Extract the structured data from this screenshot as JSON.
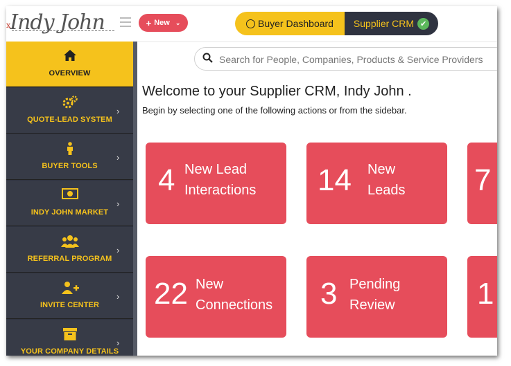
{
  "header": {
    "logo_text": "Indy John",
    "logo_mark": "x",
    "new_label": "New",
    "toggle": {
      "buyer_label": "Buyer Dashboard",
      "supplier_label": "Supplier CRM"
    }
  },
  "sidebar": {
    "items": [
      {
        "label": "OVERVIEW",
        "icon": "home-icon",
        "active": true
      },
      {
        "label": "QUOTE-LEAD SYSTEM",
        "icon": "gears-icon"
      },
      {
        "label": "BUYER TOOLS",
        "icon": "person-icon"
      },
      {
        "label": "INDY JOHN MARKET",
        "icon": "money-icon"
      },
      {
        "label": "REFERRAL PROGRAM",
        "icon": "users-icon"
      },
      {
        "label": "INVITE CENTER",
        "icon": "user-plus-icon"
      },
      {
        "label": "YOUR COMPANY DETAILS",
        "icon": "box-icon"
      }
    ]
  },
  "search": {
    "placeholder": "Search for People, Companies, Products & Service Providers"
  },
  "main": {
    "welcome": "Welcome to your Supplier CRM, Indy John .",
    "subtitle": "Begin by selecting one of the following actions or from the sidebar.",
    "cards_row1": [
      {
        "number": "4",
        "line1": "New Lead",
        "line2": "Interactions"
      },
      {
        "number": "14",
        "line1": "New",
        "line2": "Leads"
      },
      {
        "number": "7",
        "line1": "",
        "line2": ""
      }
    ],
    "cards_row2": [
      {
        "number": "22",
        "line1": "New",
        "line2": "Connections"
      },
      {
        "number": "3",
        "line1": "Pending",
        "line2": "Review"
      },
      {
        "number": "1",
        "line1": "",
        "line2": ""
      }
    ]
  },
  "colors": {
    "accent_yellow": "#f5c21c",
    "card_red": "#e64d5b",
    "sidebar_dark": "#373b47",
    "check_green": "#5cb85c"
  }
}
